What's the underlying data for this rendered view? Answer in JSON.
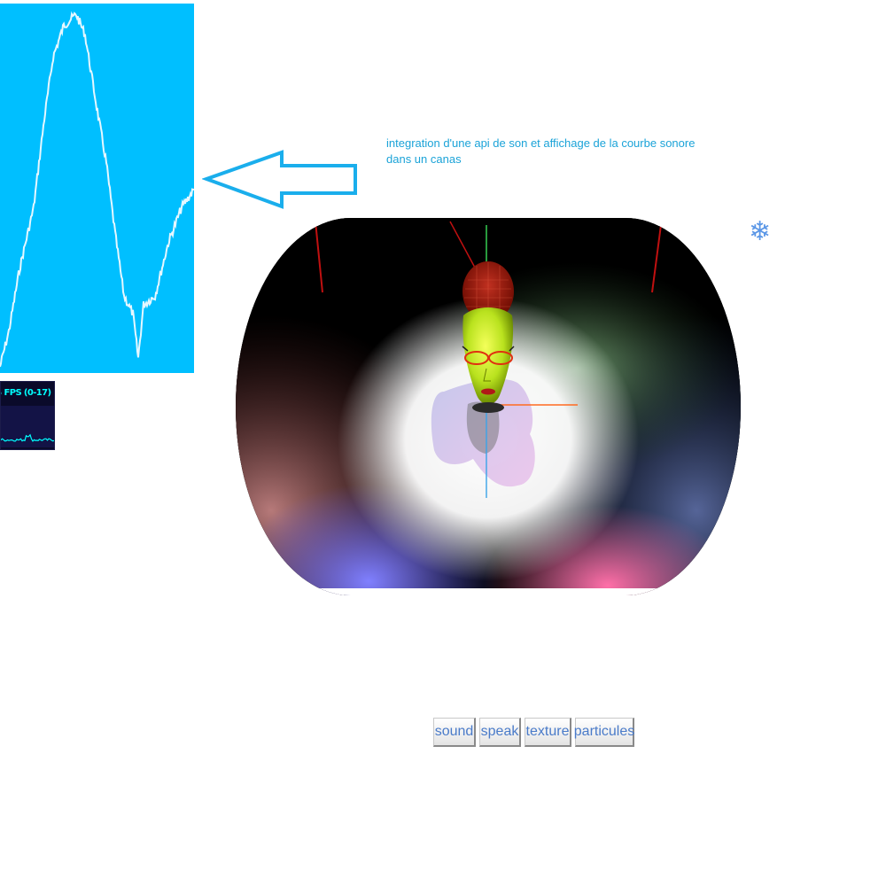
{
  "annotation": {
    "line1": "integration d'une api de son et affichage de la courbe sonore",
    "line2": "dans un canas"
  },
  "fps_panel": {
    "label": "S FPS (0-17)"
  },
  "snowflake_icon": "❄",
  "buttons": {
    "sound": "sound",
    "speak": "speak",
    "texture": "texture",
    "particules": "particules"
  },
  "colors": {
    "sound_canvas_bg": "#00bfff",
    "sound_curve": "#e6f7ff",
    "arrow": "#1aaeec",
    "annotation_text": "#1ba3d8",
    "button_text": "#4a7bc9",
    "fps_text": "#00ffff"
  }
}
